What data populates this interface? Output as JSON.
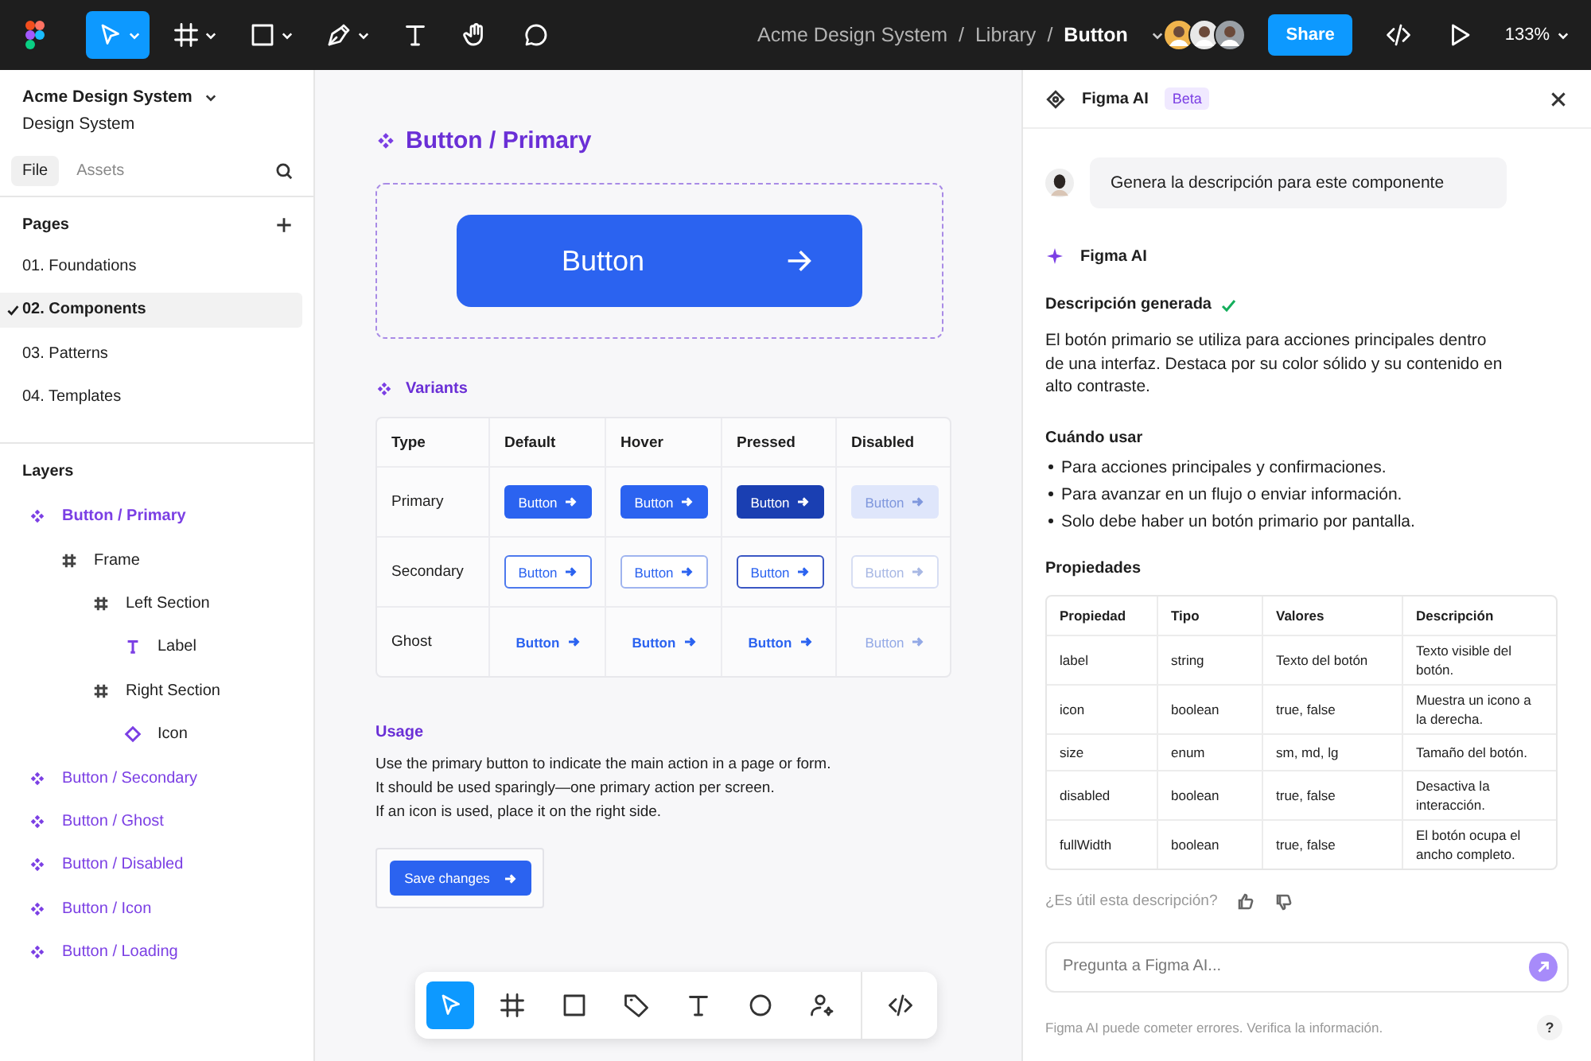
{
  "toolbar": {
    "tools": [
      {
        "kind": "move",
        "selected": true,
        "has_menu": true
      },
      {
        "kind": "frame",
        "selected": false,
        "has_menu": true
      },
      {
        "kind": "rectangle",
        "selected": false,
        "has_menu": true
      },
      {
        "kind": "pen",
        "selected": false,
        "has_menu": true
      },
      {
        "kind": "text",
        "selected": false,
        "has_menu": false
      },
      {
        "kind": "hand",
        "selected": false,
        "has_menu": false
      },
      {
        "kind": "comment",
        "selected": false,
        "has_menu": false
      }
    ],
    "breadcrumb": [
      {
        "text": "Acme Design System",
        "kind": "item"
      },
      {
        "text": "/",
        "kind": "separator"
      },
      {
        "text": "Library",
        "kind": "item"
      },
      {
        "text": "/",
        "kind": "separator"
      },
      {
        "text": "Button",
        "kind": "current"
      }
    ],
    "share": "Share",
    "zoom": "133%"
  },
  "sidebar": {
    "project": "Acme Design System",
    "subtitle": "Design System",
    "tabs": [
      {
        "label": "File",
        "selected": true
      },
      {
        "label": "Assets",
        "selected": false
      }
    ],
    "pages_title": "Pages",
    "pages": [
      {
        "label": "01. Foundations",
        "selected": false
      },
      {
        "label": "02. Components",
        "selected": true
      },
      {
        "label": "03. Patterns",
        "selected": false
      },
      {
        "label": "04. Templates",
        "selected": false
      }
    ],
    "layers_title": "Layers",
    "layers": [
      {
        "label": "Button / Primary",
        "kind": "component",
        "selected": true,
        "children": [
          {
            "label": "Frame",
            "kind": "frame",
            "selected": false,
            "children": [
              {
                "label": "Left Section",
                "kind": "frame",
                "selected": false,
                "children": [
                  {
                    "label": "Label",
                    "kind": "text",
                    "selected": false
                  }
                ]
              },
              {
                "label": "Right Section",
                "kind": "frame",
                "selected": false,
                "children": [
                  {
                    "label": "Icon",
                    "kind": "instance",
                    "selected": false
                  }
                ]
              }
            ]
          }
        ]
      },
      {
        "label": "Button / Secondary",
        "kind": "component",
        "selected": false
      },
      {
        "label": "Button / Ghost",
        "kind": "component",
        "selected": false
      },
      {
        "label": "Button / Disabled",
        "kind": "component",
        "selected": false
      },
      {
        "label": "Button / Icon",
        "kind": "component",
        "selected": false
      },
      {
        "label": "Button / Loading",
        "kind": "component",
        "selected": false
      }
    ]
  },
  "canvas": {
    "title": "Button / Primary",
    "hero_button": "Button",
    "variants_title": "Variants",
    "variants_columns": [
      "Type",
      "Default",
      "Hover",
      "Pressed",
      "Disabled"
    ],
    "variants_rows": [
      {
        "type": "Primary",
        "kind": "primary",
        "cells": [
          {
            "label": "Button",
            "kind": "default"
          },
          {
            "label": "Button",
            "kind": "hover"
          },
          {
            "label": "Button",
            "kind": "pressed"
          },
          {
            "label": "Button",
            "kind": "disabled"
          }
        ]
      },
      {
        "type": "Secondary",
        "kind": "secondary",
        "cells": [
          {
            "label": "Button",
            "kind": "default"
          },
          {
            "label": "Button",
            "kind": "hover"
          },
          {
            "label": "Button",
            "kind": "pressed"
          },
          {
            "label": "Button",
            "kind": "disabled"
          }
        ]
      },
      {
        "type": "Ghost",
        "kind": "ghost",
        "cells": [
          {
            "label": "Button",
            "kind": "default"
          },
          {
            "label": "Button",
            "kind": "hover"
          },
          {
            "label": "Button",
            "kind": "pressed"
          },
          {
            "label": "Button",
            "kind": "disabled"
          }
        ]
      }
    ],
    "usage_title": "Usage",
    "usage_lines": [
      "Use the primary button to indicate the main action in a page or form.",
      "It should be used sparingly—one primary action per screen.",
      "If an icon is used, place it on the right side."
    ],
    "example_button": "Save changes",
    "bottom_tools": [
      {
        "kind": "move",
        "selected": true
      },
      {
        "kind": "frame",
        "selected": false
      },
      {
        "kind": "rectangle",
        "selected": false
      },
      {
        "kind": "tag",
        "selected": false
      },
      {
        "kind": "text",
        "selected": false
      },
      {
        "kind": "ellipse",
        "selected": false
      },
      {
        "kind": "person",
        "selected": false
      },
      {
        "kind": "code",
        "selected": false
      }
    ]
  },
  "ai_panel": {
    "title": "Figma AI",
    "badge": "Beta",
    "prompt": "Genera la descripción para este componente",
    "responder": "Figma AI",
    "result_title": "Descripción generada",
    "paragraph": "El botón primario se utiliza para acciones principales dentro de una interfaz. Destaca por su color sólido y su contenido en alto contraste.",
    "when_title": "Cuándo usar",
    "bullets": [
      "Para acciones principales y confirmaciones.",
      "Para avanzar en un flujo o enviar información.",
      "Solo debe haber un botón primario por pantalla."
    ],
    "props_title": "Propiedades",
    "props_columns": [
      "Propiedad",
      "Tipo",
      "Valores",
      "Descripción"
    ],
    "props_rows": [
      [
        "label",
        "string",
        "Texto del botón",
        "Texto visible del botón."
      ],
      [
        "icon",
        "boolean",
        "true, false",
        "Muestra un icono a la derecha."
      ],
      [
        "size",
        "enum",
        "sm, md, lg",
        "Tamaño del botón."
      ],
      [
        "disabled",
        "boolean",
        "true, false",
        "Desactiva la interacción."
      ],
      [
        "fullWidth",
        "boolean",
        "true, false",
        "El botón ocupa el ancho completo."
      ]
    ],
    "feedback": "¿Es útil esta descripción?",
    "input_placeholder": "Pregunta a Figma AI...",
    "footer": "Figma AI puede cometer errores. Verifica la información.",
    "help": "?"
  }
}
